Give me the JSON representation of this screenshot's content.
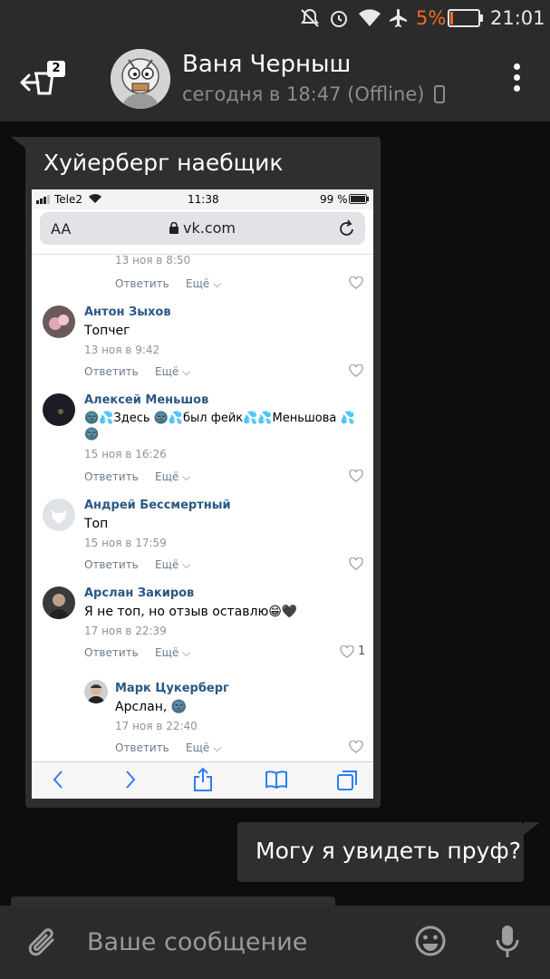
{
  "status_bar": {
    "battery": "5%",
    "time": "21:01"
  },
  "header": {
    "unread_badge": "2",
    "peer_name": "Ваня Черныш",
    "peer_status": "сегодня в 18:47 (Offline)"
  },
  "messages": {
    "incoming_caption": "Хуйерберг наебщик",
    "outgoing_text": "Могу я увидеть пруф?"
  },
  "screenshot": {
    "carrier": "Tele2",
    "time": "11:38",
    "battery": "99 %",
    "aa": "AA",
    "url": "vk.com",
    "comments": [
      {
        "date": "13 ноя в 8:50",
        "reply": "Ответить",
        "more": "Ещё"
      },
      {
        "name": "Антон Зыхов",
        "text": "Топчег",
        "date": "13 ноя в 9:42",
        "reply": "Ответить",
        "more": "Ещё"
      },
      {
        "name": "Алексей Меньшов",
        "text": "🌚💦Здесь 🌚💦был фейк💦💦Меньшова 💦",
        "text2": "🌚",
        "date": "15 ноя в 16:26",
        "reply": "Ответить",
        "more": "Ещё"
      },
      {
        "name": "Андрей Бессмертный",
        "text": "Топ",
        "date": "15 ноя в 17:59",
        "reply": "Ответить",
        "more": "Ещё"
      },
      {
        "name": "Арслан Закиров",
        "text": "Я не топ, но отзыв оставлю😁🖤",
        "date": "17 ноя в 22:39",
        "reply": "Ответить",
        "more": "Ещё",
        "likes": "1"
      },
      {
        "name": "Марк Цукерберг",
        "text": "Арслан, 🌚",
        "date": "17 ноя в 22:40",
        "reply": "Ответить",
        "more": "Ещё"
      }
    ]
  },
  "input": {
    "placeholder": "Ваше сообщение"
  },
  "icons": [
    "mute-icon",
    "alarm-icon",
    "wifi-icon",
    "airplane-icon",
    "battery-icon",
    "back-arrow-icon",
    "avatar",
    "mobile-icon",
    "more-vert-icon",
    "attach-icon",
    "emoji-icon",
    "mic-icon"
  ],
  "colors": {
    "battery_low": "#f26b23",
    "vk_link": "#2a5885",
    "bubble": "#2f2f2f",
    "bar": "#2b2b2b"
  }
}
